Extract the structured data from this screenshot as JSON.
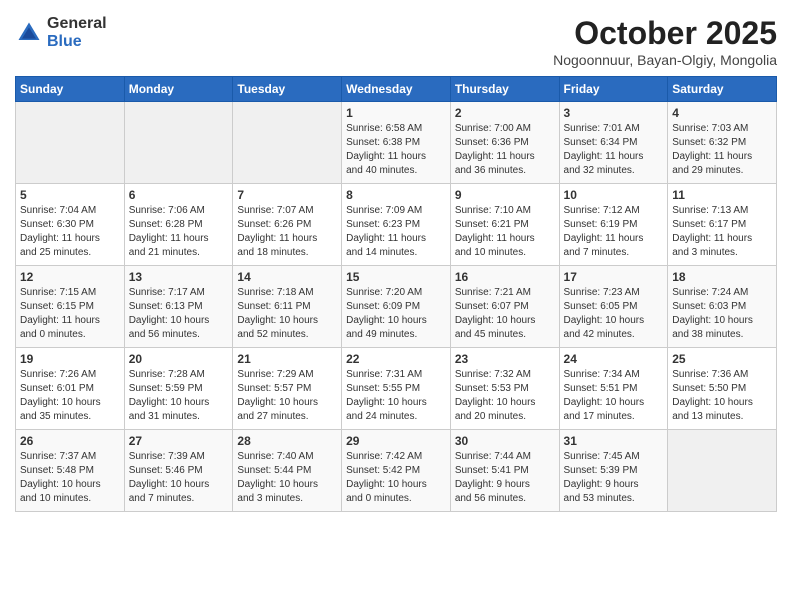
{
  "header": {
    "logo_general": "General",
    "logo_blue": "Blue",
    "month_title": "October 2025",
    "location": "Nogoonnuur, Bayan-Olgiy, Mongolia"
  },
  "weekdays": [
    "Sunday",
    "Monday",
    "Tuesday",
    "Wednesday",
    "Thursday",
    "Friday",
    "Saturday"
  ],
  "weeks": [
    [
      {
        "day": "",
        "info": ""
      },
      {
        "day": "",
        "info": ""
      },
      {
        "day": "",
        "info": ""
      },
      {
        "day": "1",
        "info": "Sunrise: 6:58 AM\nSunset: 6:38 PM\nDaylight: 11 hours\nand 40 minutes."
      },
      {
        "day": "2",
        "info": "Sunrise: 7:00 AM\nSunset: 6:36 PM\nDaylight: 11 hours\nand 36 minutes."
      },
      {
        "day": "3",
        "info": "Sunrise: 7:01 AM\nSunset: 6:34 PM\nDaylight: 11 hours\nand 32 minutes."
      },
      {
        "day": "4",
        "info": "Sunrise: 7:03 AM\nSunset: 6:32 PM\nDaylight: 11 hours\nand 29 minutes."
      }
    ],
    [
      {
        "day": "5",
        "info": "Sunrise: 7:04 AM\nSunset: 6:30 PM\nDaylight: 11 hours\nand 25 minutes."
      },
      {
        "day": "6",
        "info": "Sunrise: 7:06 AM\nSunset: 6:28 PM\nDaylight: 11 hours\nand 21 minutes."
      },
      {
        "day": "7",
        "info": "Sunrise: 7:07 AM\nSunset: 6:26 PM\nDaylight: 11 hours\nand 18 minutes."
      },
      {
        "day": "8",
        "info": "Sunrise: 7:09 AM\nSunset: 6:23 PM\nDaylight: 11 hours\nand 14 minutes."
      },
      {
        "day": "9",
        "info": "Sunrise: 7:10 AM\nSunset: 6:21 PM\nDaylight: 11 hours\nand 10 minutes."
      },
      {
        "day": "10",
        "info": "Sunrise: 7:12 AM\nSunset: 6:19 PM\nDaylight: 11 hours\nand 7 minutes."
      },
      {
        "day": "11",
        "info": "Sunrise: 7:13 AM\nSunset: 6:17 PM\nDaylight: 11 hours\nand 3 minutes."
      }
    ],
    [
      {
        "day": "12",
        "info": "Sunrise: 7:15 AM\nSunset: 6:15 PM\nDaylight: 11 hours\nand 0 minutes."
      },
      {
        "day": "13",
        "info": "Sunrise: 7:17 AM\nSunset: 6:13 PM\nDaylight: 10 hours\nand 56 minutes."
      },
      {
        "day": "14",
        "info": "Sunrise: 7:18 AM\nSunset: 6:11 PM\nDaylight: 10 hours\nand 52 minutes."
      },
      {
        "day": "15",
        "info": "Sunrise: 7:20 AM\nSunset: 6:09 PM\nDaylight: 10 hours\nand 49 minutes."
      },
      {
        "day": "16",
        "info": "Sunrise: 7:21 AM\nSunset: 6:07 PM\nDaylight: 10 hours\nand 45 minutes."
      },
      {
        "day": "17",
        "info": "Sunrise: 7:23 AM\nSunset: 6:05 PM\nDaylight: 10 hours\nand 42 minutes."
      },
      {
        "day": "18",
        "info": "Sunrise: 7:24 AM\nSunset: 6:03 PM\nDaylight: 10 hours\nand 38 minutes."
      }
    ],
    [
      {
        "day": "19",
        "info": "Sunrise: 7:26 AM\nSunset: 6:01 PM\nDaylight: 10 hours\nand 35 minutes."
      },
      {
        "day": "20",
        "info": "Sunrise: 7:28 AM\nSunset: 5:59 PM\nDaylight: 10 hours\nand 31 minutes."
      },
      {
        "day": "21",
        "info": "Sunrise: 7:29 AM\nSunset: 5:57 PM\nDaylight: 10 hours\nand 27 minutes."
      },
      {
        "day": "22",
        "info": "Sunrise: 7:31 AM\nSunset: 5:55 PM\nDaylight: 10 hours\nand 24 minutes."
      },
      {
        "day": "23",
        "info": "Sunrise: 7:32 AM\nSunset: 5:53 PM\nDaylight: 10 hours\nand 20 minutes."
      },
      {
        "day": "24",
        "info": "Sunrise: 7:34 AM\nSunset: 5:51 PM\nDaylight: 10 hours\nand 17 minutes."
      },
      {
        "day": "25",
        "info": "Sunrise: 7:36 AM\nSunset: 5:50 PM\nDaylight: 10 hours\nand 13 minutes."
      }
    ],
    [
      {
        "day": "26",
        "info": "Sunrise: 7:37 AM\nSunset: 5:48 PM\nDaylight: 10 hours\nand 10 minutes."
      },
      {
        "day": "27",
        "info": "Sunrise: 7:39 AM\nSunset: 5:46 PM\nDaylight: 10 hours\nand 7 minutes."
      },
      {
        "day": "28",
        "info": "Sunrise: 7:40 AM\nSunset: 5:44 PM\nDaylight: 10 hours\nand 3 minutes."
      },
      {
        "day": "29",
        "info": "Sunrise: 7:42 AM\nSunset: 5:42 PM\nDaylight: 10 hours\nand 0 minutes."
      },
      {
        "day": "30",
        "info": "Sunrise: 7:44 AM\nSunset: 5:41 PM\nDaylight: 9 hours\nand 56 minutes."
      },
      {
        "day": "31",
        "info": "Sunrise: 7:45 AM\nSunset: 5:39 PM\nDaylight: 9 hours\nand 53 minutes."
      },
      {
        "day": "",
        "info": ""
      }
    ]
  ]
}
